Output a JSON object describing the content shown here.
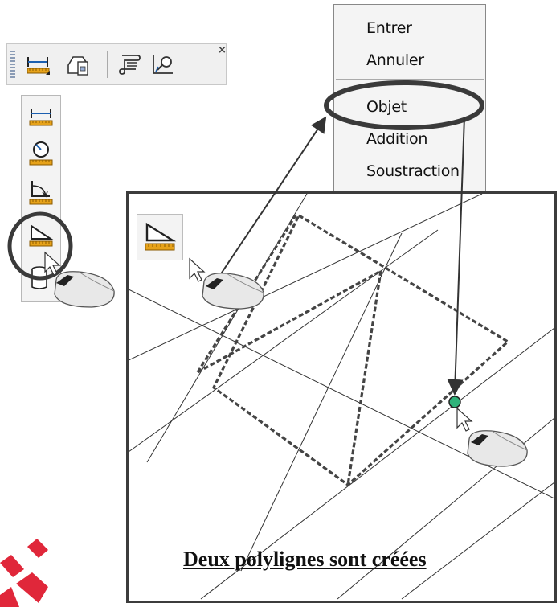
{
  "context_menu": {
    "items": [
      {
        "label": "Entrer"
      },
      {
        "label": "Annuler"
      },
      {
        "label": "Objet"
      },
      {
        "label": "Addition"
      },
      {
        "label": "Soustraction"
      }
    ],
    "highlighted": "Objet"
  },
  "toolbar": {
    "buttons": [
      {
        "icon": "linear-dimension-icon"
      },
      {
        "icon": "block-insert-icon"
      },
      {
        "icon": "text-style-icon"
      },
      {
        "icon": "zoom-region-icon"
      }
    ],
    "close_label": "×"
  },
  "flyout": {
    "buttons": [
      {
        "icon": "distance-icon"
      },
      {
        "icon": "radius-icon"
      },
      {
        "icon": "angle-icon"
      },
      {
        "icon": "area-icon",
        "selected": true
      },
      {
        "icon": "volume-icon"
      }
    ]
  },
  "canvas": {
    "caption": "Deux polylignes sont créées"
  },
  "colors": {
    "accent_ring": "#3a3a3a",
    "ruler_orange": "#e6a21a",
    "point_green": "#2fb37a"
  }
}
